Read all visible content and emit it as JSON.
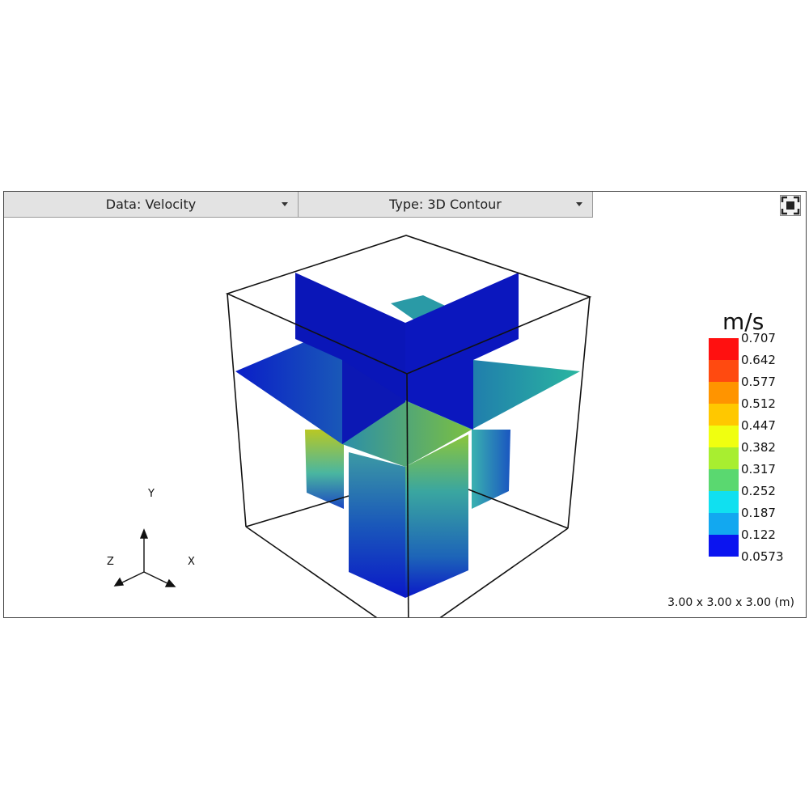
{
  "toolbar": {
    "data_select": "Data: Velocity",
    "type_select": "Type: 3D Contour",
    "fullscreen_icon": "fullscreen-icon"
  },
  "legend": {
    "unit": "m/s",
    "values": [
      "0.707",
      "0.642",
      "0.577",
      "0.512",
      "0.447",
      "0.382",
      "0.317",
      "0.252",
      "0.187",
      "0.122",
      "0.0573"
    ],
    "colors": [
      "#ff1010",
      "#ff4a10",
      "#ff9400",
      "#ffc800",
      "#f0ff10",
      "#a8ee30",
      "#5ad870",
      "#10e0f0",
      "#12a8f0",
      "#1270f0",
      "#0b14f0"
    ]
  },
  "axes": {
    "y": "Y",
    "x": "X",
    "z": "Z"
  },
  "dimensions": "3.00 x 3.00 x 3.00 (m)",
  "palette": {
    "low": "#0a14c8",
    "mid": "#2aa6a8",
    "high": "#b8c818"
  }
}
